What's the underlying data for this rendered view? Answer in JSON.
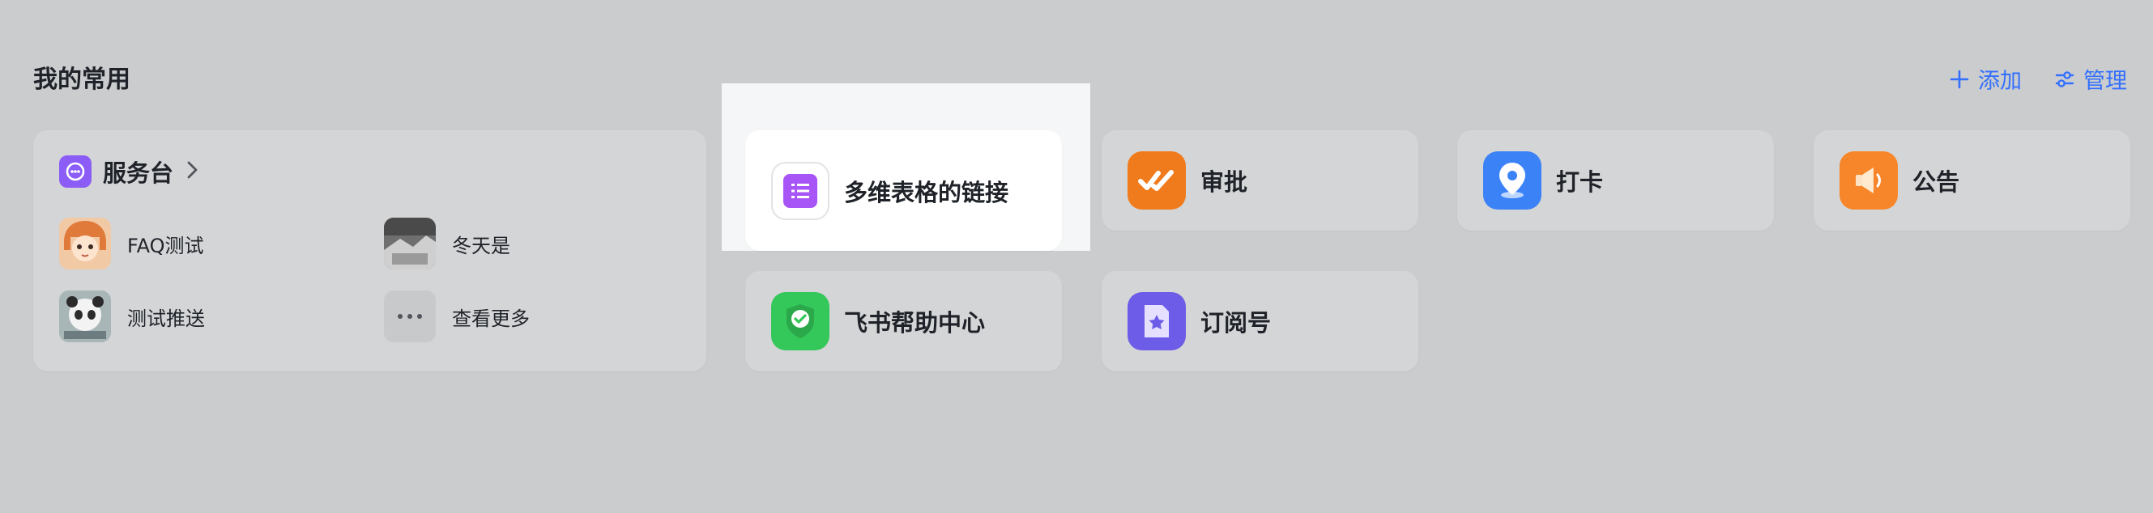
{
  "header": {
    "title": "我的常用",
    "add_label": "添加",
    "manage_label": "管理"
  },
  "service_desk": {
    "title": "服务台",
    "items": [
      {
        "label": "FAQ测试"
      },
      {
        "label": "冬天是"
      },
      {
        "label": "测试推送"
      },
      {
        "label": "查看更多"
      }
    ]
  },
  "apps": [
    {
      "label": "多维表格的链接",
      "icon": "list-icon",
      "color": "#a855f7"
    },
    {
      "label": "审批",
      "icon": "double-check-icon",
      "color": "#f07b1d"
    },
    {
      "label": "打卡",
      "icon": "location-pin-icon",
      "color": "#3b82f6"
    },
    {
      "label": "公告",
      "icon": "megaphone-icon",
      "color": "#f7862a"
    },
    {
      "label": "飞书帮助中心",
      "icon": "help-shield-icon",
      "color": "#34c759"
    },
    {
      "label": "订阅号",
      "icon": "star-document-icon",
      "color": "#6d5ce7"
    }
  ],
  "colors": {
    "accent": "#3370ff",
    "background": "#cbcccd",
    "card": "#d4d5d6"
  }
}
